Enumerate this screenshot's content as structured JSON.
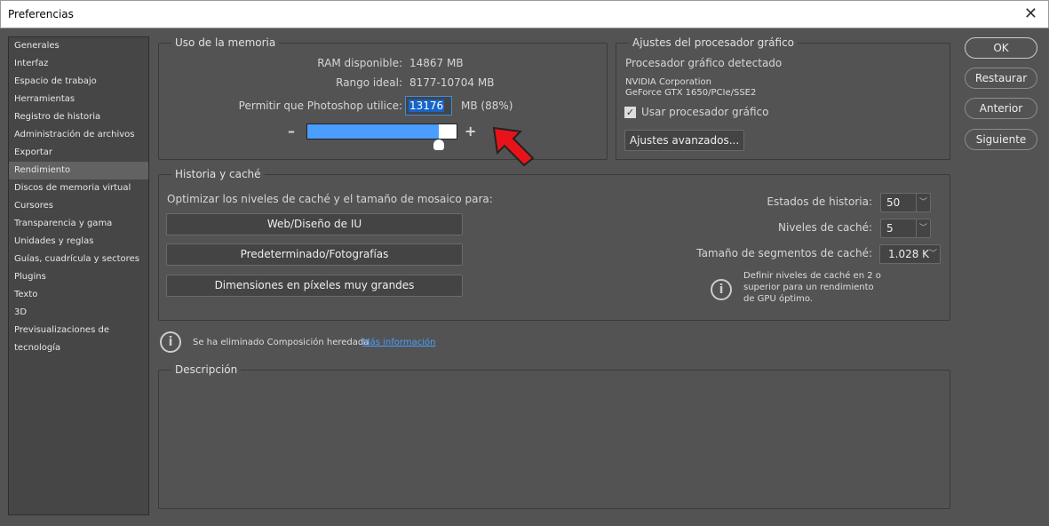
{
  "window": {
    "title": "Preferencias",
    "close_icon": "close-icon"
  },
  "sidebar": {
    "items": [
      "Generales",
      "Interfaz",
      "Espacio de trabajo",
      "Herramientas",
      "Registro de historia",
      "Administración de archivos",
      "Exportar",
      "Rendimiento",
      "Discos de memoria virtual",
      "Cursores",
      "Transparencia y gama",
      "Unidades y reglas",
      "Guías, cuadrícula y sectores",
      "Plugins",
      "Texto",
      "3D",
      "Previsualizaciones de tecnología"
    ],
    "selected": "Rendimiento"
  },
  "memory": {
    "title": "Uso de la memoria",
    "ram_label": "RAM disponible:",
    "ram_value": "14867 MB",
    "ideal_label": "Rango ideal:",
    "ideal_value": "8177-10704 MB",
    "allow_label": "Permitir que Photoshop utilice:",
    "allow_value": "13176",
    "allow_unit": "MB (88%)",
    "slider_percent": 88,
    "minus": "–",
    "plus": "+",
    "accent": "#4a9eff"
  },
  "gpu": {
    "title": "Ajustes del procesador gráfico",
    "detected": "Procesador gráfico detectado",
    "vendor": "NVIDIA Corporation",
    "model": "GeForce GTX 1650/PCIe/SSE2",
    "use_gpu_label": "Usar procesador gráfico",
    "use_gpu_checked": true,
    "advanced_button": "Ajustes avanzados..."
  },
  "history": {
    "title": "Historia y caché",
    "optimize_label": "Optimizar los niveles de caché y el tamaño de mosaico para:",
    "buttons": [
      "Web/Diseño de IU",
      "Predeterminado/Fotografías",
      "Dimensiones en píxeles muy grandes"
    ],
    "states_label": "Estados de historia:",
    "states_value": "50",
    "levels_label": "Niveles de caché:",
    "levels_value": "5",
    "tile_label": "Tamaño de segmentos de caché:",
    "tile_value": "1.028 K",
    "hint": "Definir niveles de caché en 2 o superior para un rendimiento de GPU óptimo."
  },
  "notice": {
    "text": "Se ha eliminado Composición heredada",
    "link": "Más información"
  },
  "description": {
    "title": "Descripción"
  },
  "actions": {
    "ok": "OK",
    "reset": "Restaurar",
    "prev": "Anterior",
    "next": "Siguiente"
  }
}
